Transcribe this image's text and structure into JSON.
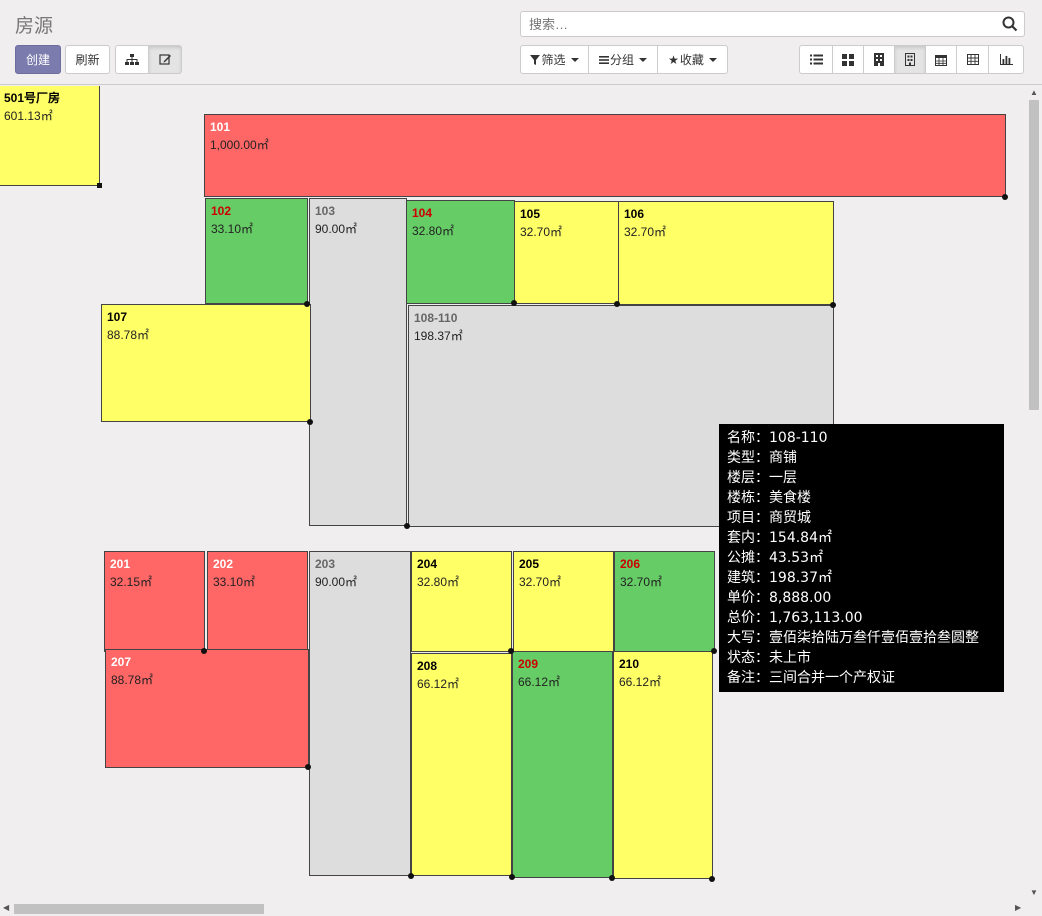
{
  "header": {
    "title": "房源",
    "search_placeholder": "搜索…",
    "create_label": "创建",
    "refresh_label": "刷新",
    "filter_label": "筛选",
    "group_label": "分组",
    "favorite_label": "收藏"
  },
  "colors": {
    "red": "#ff6666",
    "green": "#66cc66",
    "yellow": "#ffff66",
    "grey": "#dddddd",
    "primary": "#7c7bad"
  },
  "rooms": {
    "r501": {
      "name": "501号厂房",
      "area": "601.13㎡"
    },
    "r101": {
      "name": "101",
      "area": "1,000.00㎡"
    },
    "r102": {
      "name": "102",
      "area": "33.10㎡"
    },
    "r103": {
      "name": "103",
      "area": "90.00㎡"
    },
    "r104": {
      "name": "104",
      "area": "32.80㎡"
    },
    "r105": {
      "name": "105",
      "area": "32.70㎡"
    },
    "r106": {
      "name": "106",
      "area": "32.70㎡"
    },
    "r107": {
      "name": "107",
      "area": "88.78㎡"
    },
    "r108": {
      "name": "108-110",
      "area": "198.37㎡"
    },
    "r201": {
      "name": "201",
      "area": "32.15㎡"
    },
    "r202": {
      "name": "202",
      "area": "33.10㎡"
    },
    "r203": {
      "name": "203",
      "area": "90.00㎡"
    },
    "r204": {
      "name": "204",
      "area": "32.80㎡"
    },
    "r205": {
      "name": "205",
      "area": "32.70㎡"
    },
    "r206": {
      "name": "206",
      "area": "32.70㎡"
    },
    "r207": {
      "name": "207",
      "area": "88.78㎡"
    },
    "r208": {
      "name": "208",
      "area": "66.12㎡"
    },
    "r209": {
      "name": "209",
      "area": "66.12㎡"
    },
    "r210": {
      "name": "210",
      "area": "66.12㎡"
    }
  },
  "tooltip": {
    "lines": [
      "名称：108-110",
      "类型：商铺",
      "楼层：一层",
      "楼栋：美食楼",
      "项目：商贸城",
      "套内：154.84㎡",
      "公摊：43.53㎡",
      "建筑：198.37㎡",
      "单价：8,888.00",
      "总价：1,763,113.00",
      "大写：壹佰柒拾陆万叁仟壹佰壹拾叁圆整",
      "状态：未上市",
      "备注：三间合并一个产权证"
    ]
  }
}
